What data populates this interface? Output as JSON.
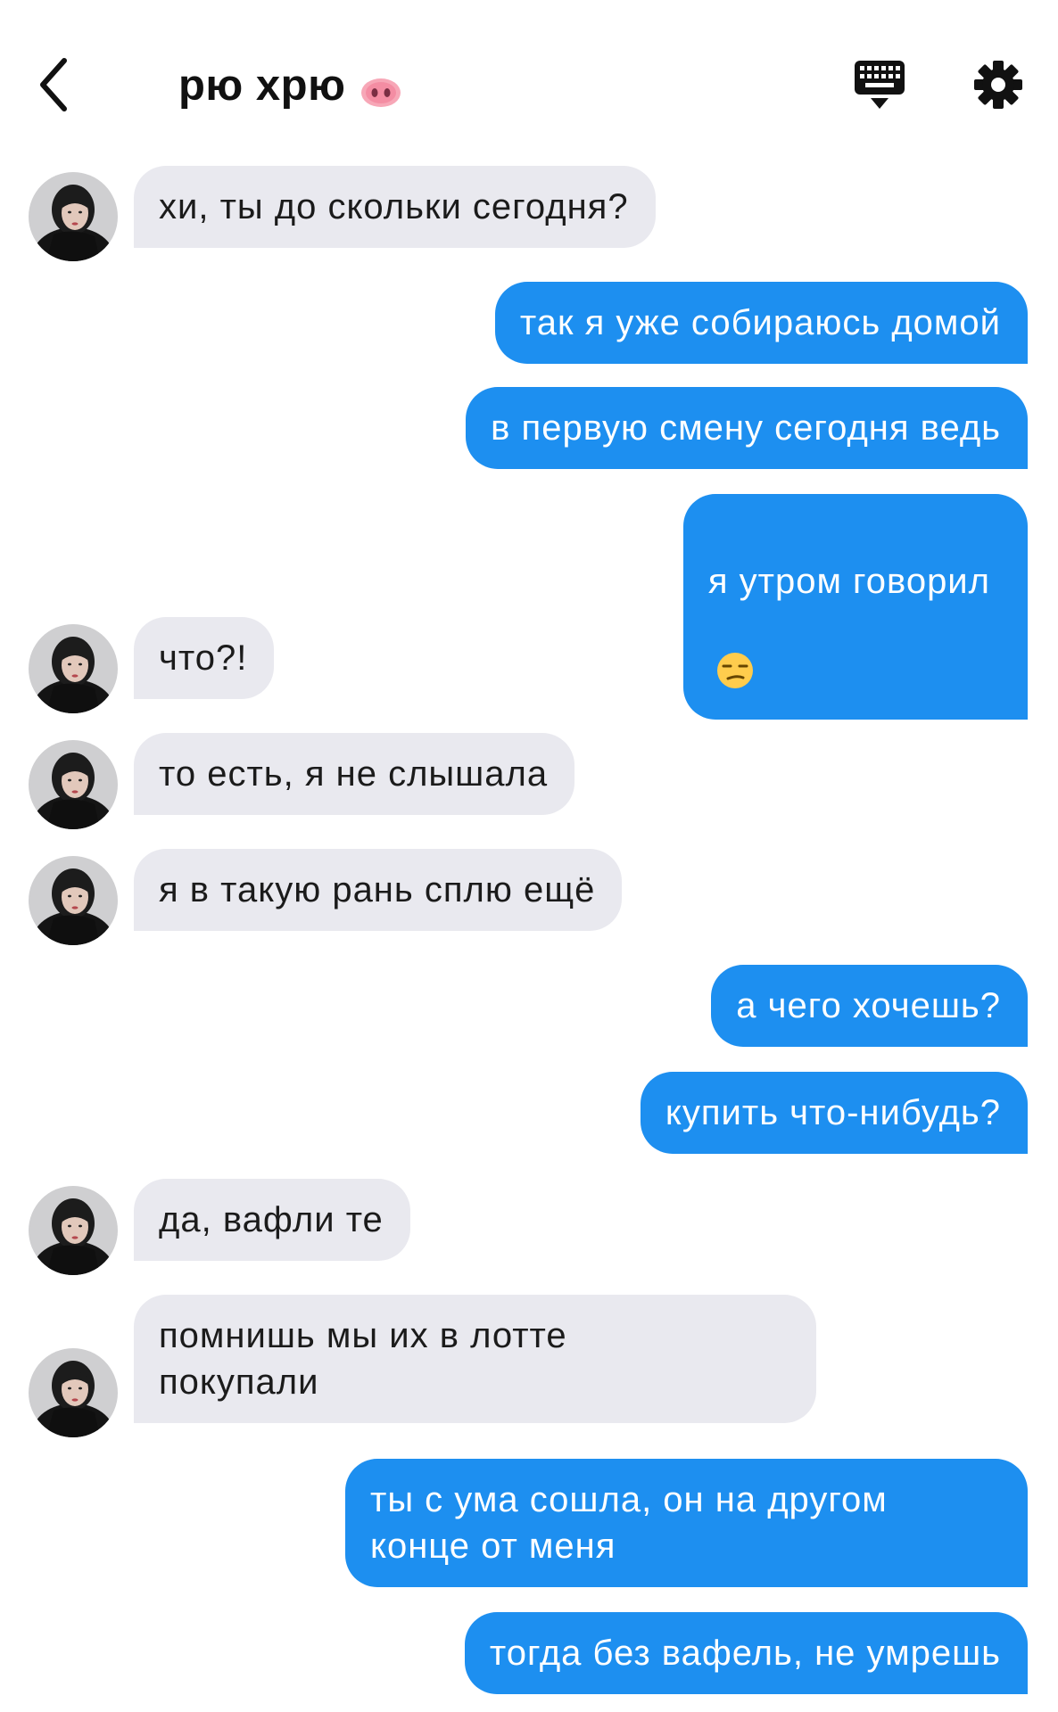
{
  "header": {
    "title": "рю хрю",
    "title_emoji": "pig-nose-emoji",
    "icons": [
      "back-chevron-icon",
      "keyboard-icon",
      "gear-icon"
    ]
  },
  "colors": {
    "outgoing": "#1d8ff0",
    "incoming": "#e9e9ef",
    "outgoing_text": "#ffffff",
    "incoming_text": "#1b1b1b"
  },
  "messages": [
    {
      "from": "them",
      "text": "хи, ты до скольки сегодня?"
    },
    {
      "from": "me",
      "text": "так я уже собираюсь домой"
    },
    {
      "from": "me",
      "text": "в первую смену сегодня ведь"
    },
    {
      "from": "me",
      "text": "я утром говорил",
      "emoji": "unamused-face-emoji"
    },
    {
      "from": "them",
      "text": "что?!"
    },
    {
      "from": "them",
      "text": "то есть, я не слышала"
    },
    {
      "from": "them",
      "text": "я в такую рань сплю ещё"
    },
    {
      "from": "me",
      "text": "а чего хочешь?"
    },
    {
      "from": "me",
      "text": "купить что-нибудь?"
    },
    {
      "from": "them",
      "text": "да, вафли те"
    },
    {
      "from": "them",
      "text": "помнишь мы их в лотте\nпокупали"
    },
    {
      "from": "me",
      "text": "ты с ума сошла, он на другом\nконце от меня"
    },
    {
      "from": "me",
      "text": "тогда без вафель, не умрешь"
    }
  ]
}
